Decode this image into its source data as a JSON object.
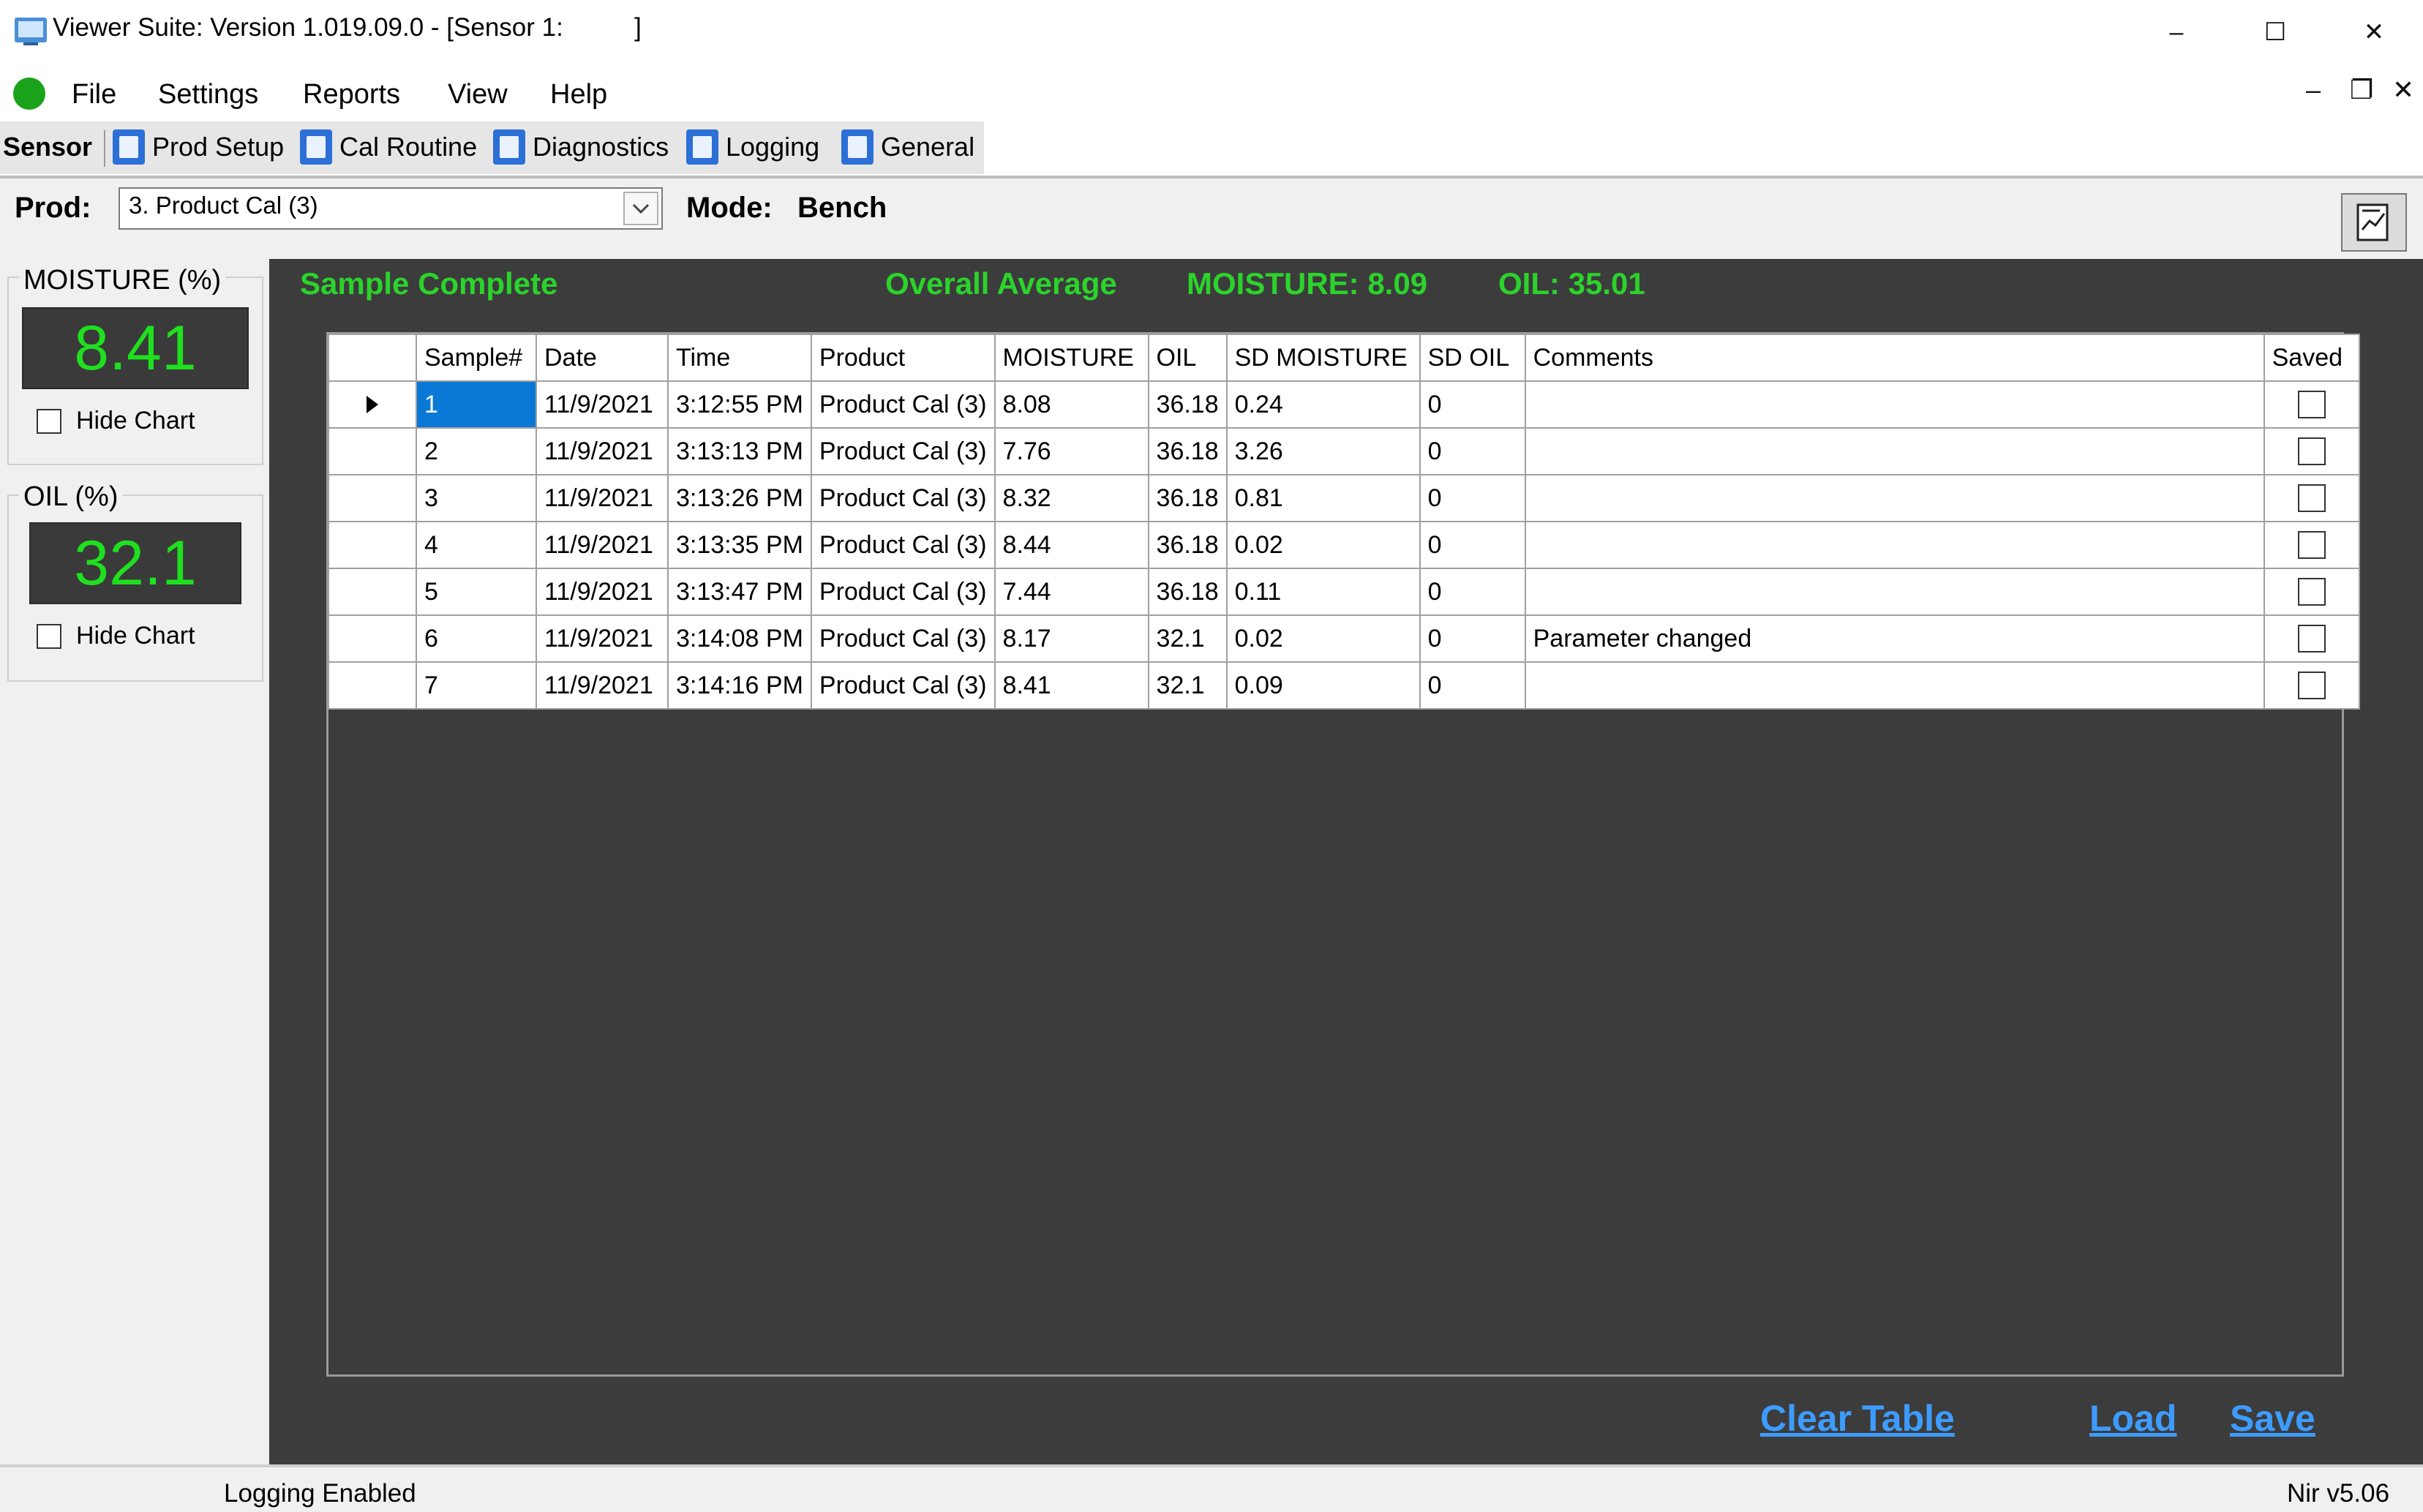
{
  "window": {
    "title": "Viewer Suite: Version 1.019.09.0 - [Sensor 1:          ]",
    "minimize": "–",
    "maximize": "☐",
    "close": "✕"
  },
  "menu": {
    "items": [
      "File",
      "Settings",
      "Reports",
      "View",
      "Help"
    ],
    "mdi_minimize": "–",
    "mdi_restore": "❐",
    "mdi_close": "✕"
  },
  "toolbar": {
    "sensor": "Sensor",
    "buttons": [
      "Prod Setup",
      "Cal Routine",
      "Diagnostics",
      "Logging",
      "General"
    ]
  },
  "prod": {
    "label": "Prod:",
    "value": "3. Product Cal (3)",
    "mode_label": "Mode:",
    "mode_value": "Bench"
  },
  "panels": {
    "moisture": {
      "title": "MOISTURE (%)",
      "value": "8.41",
      "hide_chart": "Hide Chart"
    },
    "oil": {
      "title": "OIL (%)",
      "value": "32.1",
      "hide_chart": "Hide Chart"
    }
  },
  "status": {
    "sample": "Sample Complete",
    "overall": "Overall Average",
    "moisture_avg": "MOISTURE: 8.09",
    "oil_avg": "OIL: 35.01"
  },
  "table": {
    "headers": [
      "Sample#",
      "Date",
      "Time",
      "Product",
      "MOISTURE",
      "OIL",
      "SD MOISTURE",
      "SD OIL",
      "Comments",
      "Saved"
    ],
    "rows": [
      [
        "1",
        "11/9/2021",
        "3:12:55 PM",
        "Product Cal (3)",
        "8.08",
        "36.18",
        "0.24",
        "0",
        ""
      ],
      [
        "2",
        "11/9/2021",
        "3:13:13 PM",
        "Product Cal (3)",
        "7.76",
        "36.18",
        "3.26",
        "0",
        ""
      ],
      [
        "3",
        "11/9/2021",
        "3:13:26 PM",
        "Product Cal (3)",
        "8.32",
        "36.18",
        "0.81",
        "0",
        ""
      ],
      [
        "4",
        "11/9/2021",
        "3:13:35 PM",
        "Product Cal (3)",
        "8.44",
        "36.18",
        "0.02",
        "0",
        ""
      ],
      [
        "5",
        "11/9/2021",
        "3:13:47 PM",
        "Product Cal (3)",
        "7.44",
        "36.18",
        "0.11",
        "0",
        ""
      ],
      [
        "6",
        "11/9/2021",
        "3:14:08 PM",
        "Product Cal (3)",
        "8.17",
        "32.1",
        "0.02",
        "0",
        "Parameter changed"
      ],
      [
        "7",
        "11/9/2021",
        "3:14:16 PM",
        "Product Cal (3)",
        "8.41",
        "32.1",
        "0.09",
        "0",
        ""
      ]
    ]
  },
  "links": {
    "clear": "Clear Table",
    "load": "Load",
    "save": "Save"
  },
  "statusbar": {
    "left": "Logging Enabled",
    "right": "Nir v5.06"
  },
  "colors": {
    "green": "#2bd32b",
    "readout_green": "#1fe01f",
    "link_blue": "#3d9cff",
    "selection": "#0a78d7",
    "dark_bg": "#3c3c3c"
  }
}
